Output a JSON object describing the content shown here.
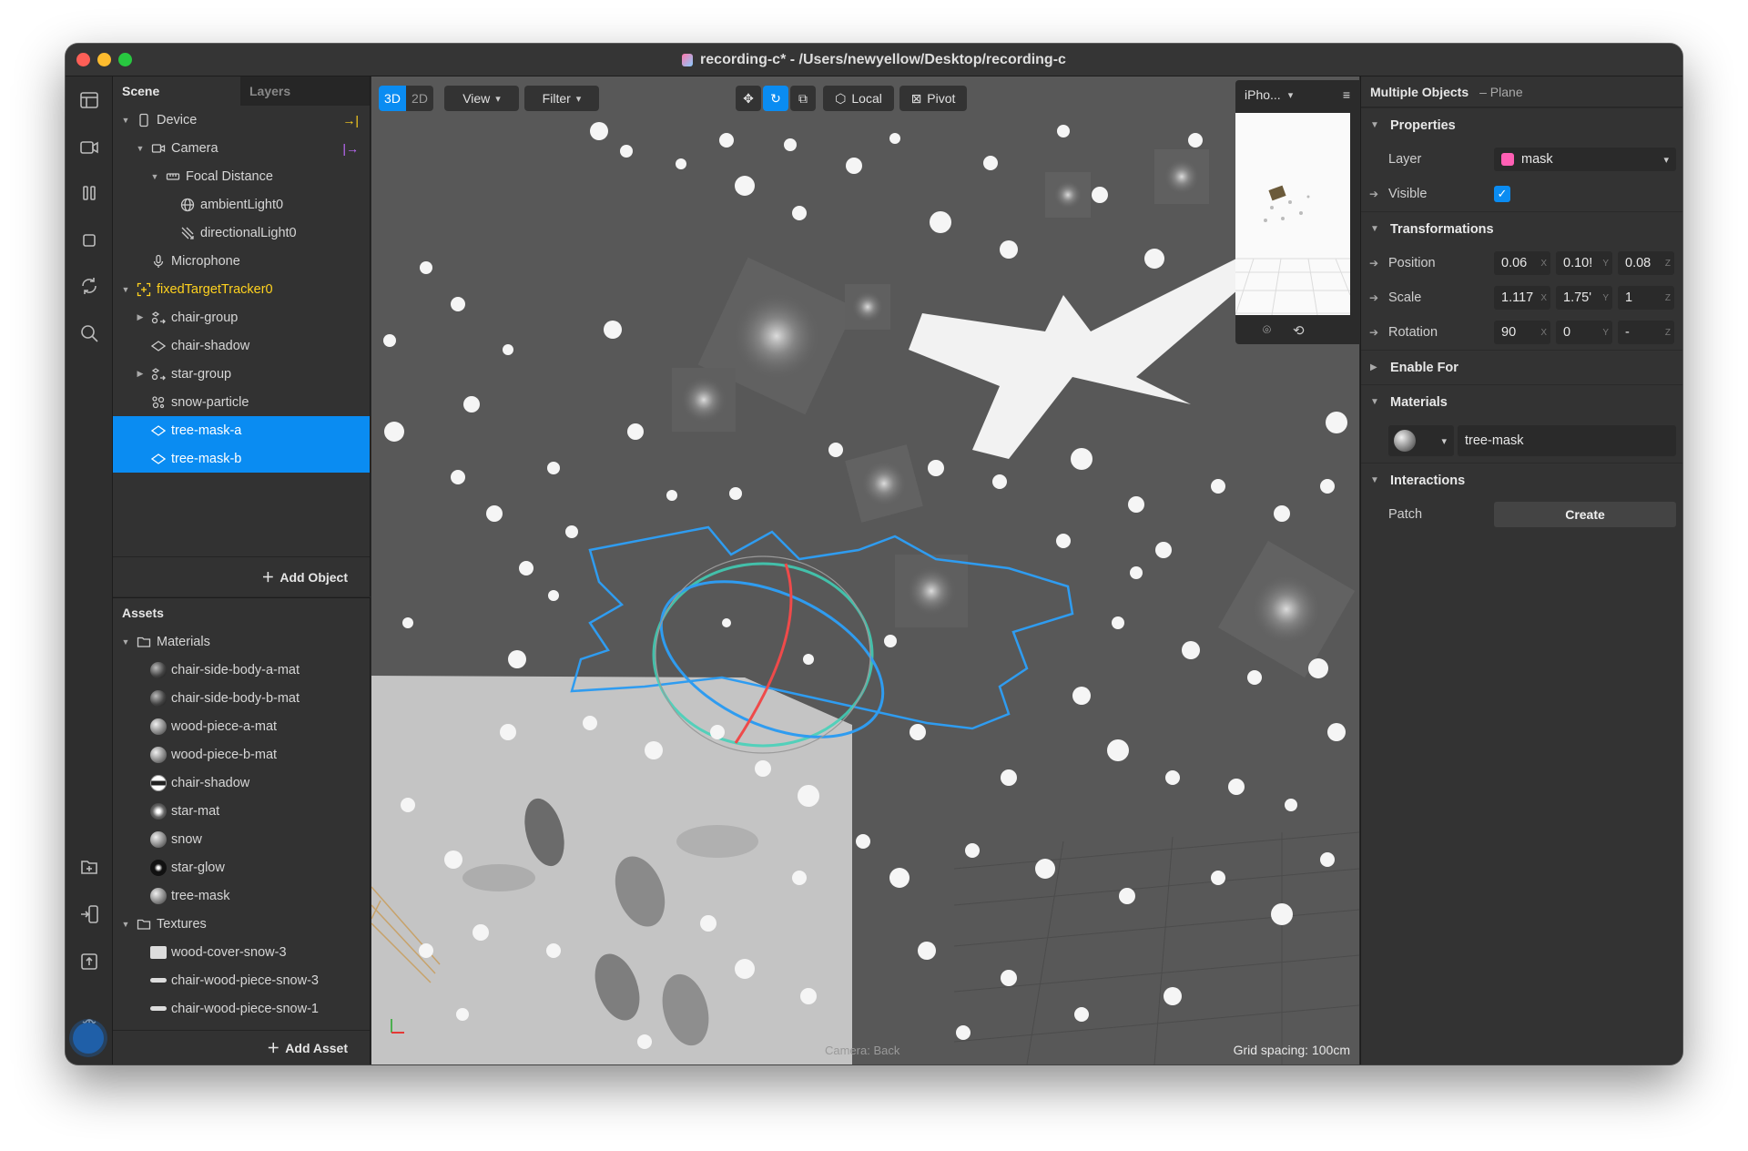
{
  "window": {
    "title": "recording-c* - /Users/newyellow/Desktop/recording-c"
  },
  "scene_panel": {
    "tabs": [
      "Scene",
      "Layers"
    ],
    "items": [
      {
        "label": "Device",
        "icon": "device-icon"
      },
      {
        "label": "Camera",
        "icon": "camera-icon"
      },
      {
        "label": "Focal Distance",
        "icon": "focal-distance-icon"
      },
      {
        "label": "ambientLight0",
        "icon": "globe-light-icon"
      },
      {
        "label": "directionalLight0",
        "icon": "directional-light-icon"
      },
      {
        "label": "Microphone",
        "icon": "microphone-icon"
      },
      {
        "label": "fixedTargetTracker0",
        "icon": "tracker-icon"
      },
      {
        "label": "chair-group",
        "icon": "group-icon"
      },
      {
        "label": "chair-shadow",
        "icon": "plane-icon"
      },
      {
        "label": "star-group",
        "icon": "group-icon"
      },
      {
        "label": "snow-particle",
        "icon": "particle-icon"
      },
      {
        "label": "tree-mask-a",
        "icon": "plane-icon"
      },
      {
        "label": "tree-mask-b",
        "icon": "plane-icon"
      }
    ],
    "add_object": "Add Object"
  },
  "assets_panel": {
    "title": "Assets",
    "materials_folder": "Materials",
    "materials": [
      "chair-side-body-a-mat",
      "chair-side-body-b-mat",
      "wood-piece-a-mat",
      "wood-piece-b-mat",
      "chair-shadow",
      "star-mat",
      "snow",
      "star-glow",
      "tree-mask"
    ],
    "textures_folder": "Textures",
    "textures": [
      "wood-cover-snow-3",
      "chair-wood-piece-snow-3",
      "chair-wood-piece-snow-1"
    ],
    "add_asset": "Add Asset"
  },
  "viewport": {
    "mode_3d": "3D",
    "mode_2d": "2D",
    "view_label": "View",
    "filter_label": "Filter",
    "local_label": "Local",
    "pivot_label": "Pivot",
    "device_label": "iPho...",
    "grid_spacing": "Grid spacing: 100cm",
    "camera_label": "Camera: Back"
  },
  "inspector": {
    "title": "Multiple Objects",
    "subtitle": "– Plane",
    "properties_section": "Properties",
    "layer_label": "Layer",
    "layer_value": "mask",
    "layer_color": "#ff5fb4",
    "visible_label": "Visible",
    "visible_checked": true,
    "transformations_section": "Transformations",
    "position_label": "Position",
    "position": [
      "0.06",
      "0.10!",
      "0.08"
    ],
    "scale_label": "Scale",
    "scale": [
      "1.117",
      "1.75'",
      "1"
    ],
    "rotation_label": "Rotation",
    "rotation": [
      "90",
      "0",
      "-"
    ],
    "axes": [
      "X",
      "Y",
      "Z"
    ],
    "enable_for_section": "Enable For",
    "materials_section": "Materials",
    "material_value": "tree-mask",
    "interactions_section": "Interactions",
    "patch_label": "Patch",
    "create_label": "Create"
  },
  "colors": {
    "accent": "#0a8cf2",
    "tracker": "#ffd21f",
    "camera_link": "#c06cff"
  }
}
